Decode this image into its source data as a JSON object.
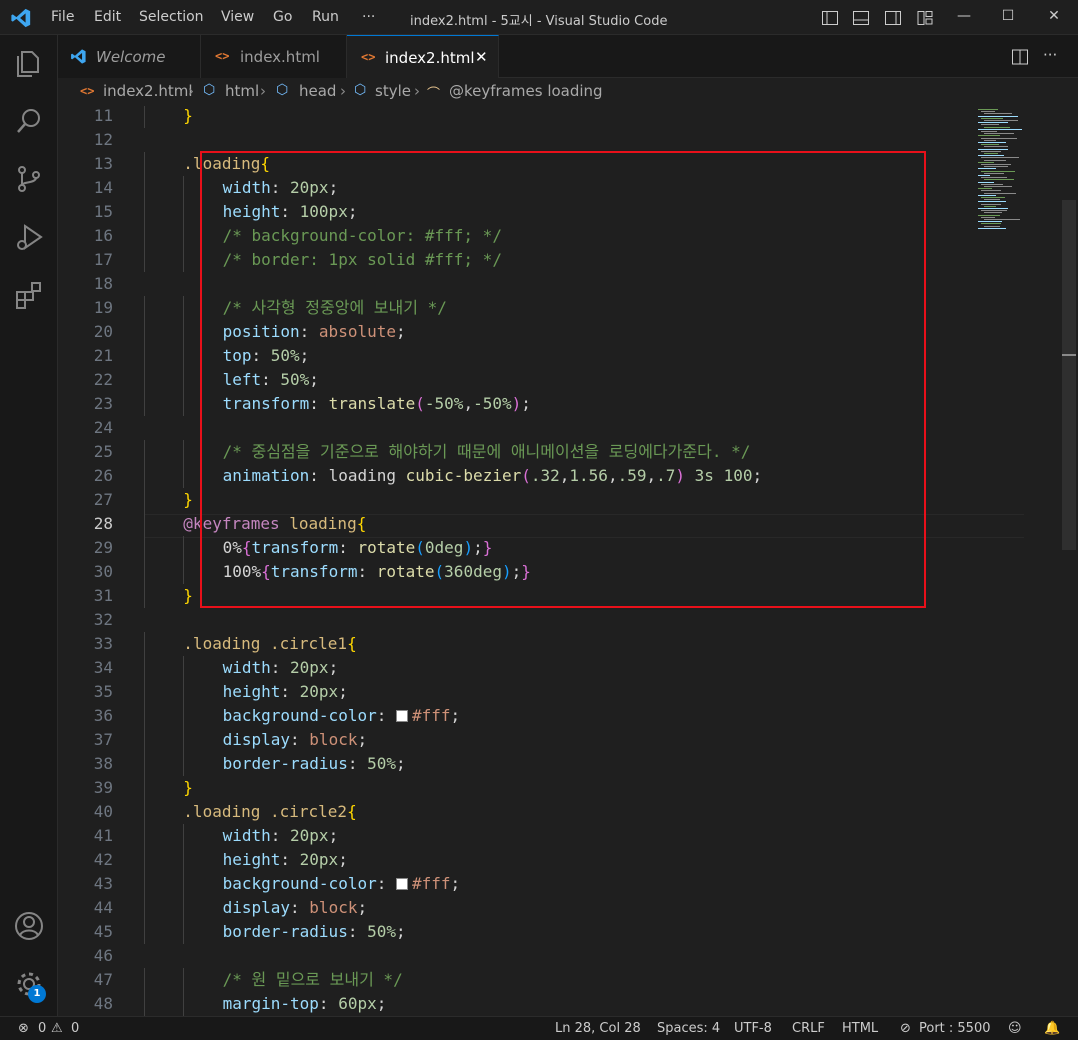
{
  "titlebar": {
    "menus": [
      "File",
      "Edit",
      "Selection",
      "View",
      "Go",
      "Run",
      "···"
    ],
    "window_title": "index2.html - 5교시 - Visual Studio Code"
  },
  "tabs": [
    {
      "label": "Welcome",
      "icon": "vscode-logo-icon",
      "active": false
    },
    {
      "label": "index.html",
      "icon": "html-file-icon",
      "active": false
    },
    {
      "label": "index2.html",
      "icon": "html-file-icon",
      "active": true
    }
  ],
  "breadcrumb": [
    "index2.html",
    "html",
    "head",
    "style",
    "@keyframes loading"
  ],
  "editor": {
    "current_line": 28,
    "lines": [
      {
        "n": "11",
        "indent": 2,
        "tokens": [
          [
            "br1",
            "}"
          ]
        ]
      },
      {
        "n": "12",
        "indent": 0,
        "tokens": []
      },
      {
        "n": "13",
        "indent": 2,
        "tokens": [
          [
            "sel",
            ".loading"
          ],
          [
            "br1",
            "{"
          ]
        ]
      },
      {
        "n": "14",
        "indent": 3,
        "tokens": [
          [
            "prop",
            "width"
          ],
          [
            "",
            ": "
          ],
          [
            "num",
            "20px"
          ],
          [
            "",
            ";"
          ]
        ]
      },
      {
        "n": "15",
        "indent": 3,
        "tokens": [
          [
            "prop",
            "height"
          ],
          [
            "",
            ": "
          ],
          [
            "num",
            "100px"
          ],
          [
            "",
            ";"
          ]
        ]
      },
      {
        "n": "16",
        "indent": 3,
        "tokens": [
          [
            "cmt",
            "/* background-color: #fff; */"
          ]
        ]
      },
      {
        "n": "17",
        "indent": 3,
        "tokens": [
          [
            "cmt",
            "/* border: 1px solid #fff; */"
          ]
        ]
      },
      {
        "n": "18",
        "indent": 0,
        "tokens": []
      },
      {
        "n": "19",
        "indent": 3,
        "tokens": [
          [
            "cmt",
            "/* 사각형 정중앙에 보내기 */"
          ]
        ]
      },
      {
        "n": "20",
        "indent": 3,
        "tokens": [
          [
            "prop",
            "position"
          ],
          [
            "",
            ": "
          ],
          [
            "val",
            "absolute"
          ],
          [
            "",
            ";"
          ]
        ]
      },
      {
        "n": "21",
        "indent": 3,
        "tokens": [
          [
            "prop",
            "top"
          ],
          [
            "",
            ": "
          ],
          [
            "num",
            "50%"
          ],
          [
            "",
            ";"
          ]
        ]
      },
      {
        "n": "22",
        "indent": 3,
        "tokens": [
          [
            "prop",
            "left"
          ],
          [
            "",
            ": "
          ],
          [
            "num",
            "50%"
          ],
          [
            "",
            ";"
          ]
        ]
      },
      {
        "n": "23",
        "indent": 3,
        "tokens": [
          [
            "prop",
            "transform"
          ],
          [
            "",
            ": "
          ],
          [
            "fn",
            "translate"
          ],
          [
            "br2",
            "("
          ],
          [
            "num",
            "-50%"
          ],
          [
            "",
            ","
          ],
          [
            "num",
            "-50%"
          ],
          [
            "br2",
            ")"
          ],
          [
            "",
            ";"
          ]
        ]
      },
      {
        "n": "24",
        "indent": 0,
        "tokens": []
      },
      {
        "n": "25",
        "indent": 3,
        "tokens": [
          [
            "cmt",
            "/* 중심점을 기준으로 해야하기 때문에 애니메이션을 로딩에다가준다. */"
          ]
        ]
      },
      {
        "n": "26",
        "indent": 3,
        "tokens": [
          [
            "prop",
            "animation"
          ],
          [
            "",
            ": "
          ],
          [
            "",
            "loading "
          ],
          [
            "fn",
            "cubic-bezier"
          ],
          [
            "br2",
            "("
          ],
          [
            "num",
            ".32"
          ],
          [
            "",
            ","
          ],
          [
            "num",
            "1.56"
          ],
          [
            "",
            ","
          ],
          [
            "num",
            ".59"
          ],
          [
            "",
            ","
          ],
          [
            "num",
            ".7"
          ],
          [
            "br2",
            ")"
          ],
          [
            "",
            " "
          ],
          [
            "num",
            "3s"
          ],
          [
            "",
            " "
          ],
          [
            "num",
            "100"
          ],
          [
            "",
            ";"
          ]
        ]
      },
      {
        "n": "27",
        "indent": 2,
        "tokens": [
          [
            "br1",
            "}"
          ]
        ]
      },
      {
        "n": "28",
        "indent": 2,
        "tokens": [
          [
            "at",
            "@keyframes"
          ],
          [
            "",
            " "
          ],
          [
            "sel",
            "loading"
          ],
          [
            "br1",
            "{"
          ]
        ]
      },
      {
        "n": "29",
        "indent": 3,
        "tokens": [
          [
            "",
            "0%"
          ],
          [
            "br2",
            "{"
          ],
          [
            "prop",
            "transform"
          ],
          [
            "",
            ": "
          ],
          [
            "fn",
            "rotate"
          ],
          [
            "br3",
            "("
          ],
          [
            "num",
            "0deg"
          ],
          [
            "br3",
            ")"
          ],
          [
            "",
            ";"
          ],
          [
            "br2",
            "}"
          ]
        ]
      },
      {
        "n": "30",
        "indent": 3,
        "tokens": [
          [
            "",
            "100%"
          ],
          [
            "br2",
            "{"
          ],
          [
            "prop",
            "transform"
          ],
          [
            "",
            ": "
          ],
          [
            "fn",
            "rotate"
          ],
          [
            "br3",
            "("
          ],
          [
            "num",
            "360deg"
          ],
          [
            "br3",
            ")"
          ],
          [
            "",
            ";"
          ],
          [
            "br2",
            "}"
          ]
        ]
      },
      {
        "n": "31",
        "indent": 2,
        "tokens": [
          [
            "br1",
            "}"
          ]
        ]
      },
      {
        "n": "32",
        "indent": 0,
        "tokens": []
      },
      {
        "n": "33",
        "indent": 2,
        "tokens": [
          [
            "sel",
            ".loading .circle1"
          ],
          [
            "br1",
            "{"
          ]
        ]
      },
      {
        "n": "34",
        "indent": 3,
        "tokens": [
          [
            "prop",
            "width"
          ],
          [
            "",
            ": "
          ],
          [
            "num",
            "20px"
          ],
          [
            "",
            ";"
          ]
        ]
      },
      {
        "n": "35",
        "indent": 3,
        "tokens": [
          [
            "prop",
            "height"
          ],
          [
            "",
            ": "
          ],
          [
            "num",
            "20px"
          ],
          [
            "",
            ";"
          ]
        ]
      },
      {
        "n": "36",
        "indent": 3,
        "tokens": [
          [
            "prop",
            "background-color"
          ],
          [
            "",
            ": "
          ],
          [
            "swatch",
            ""
          ],
          [
            "val",
            "#fff"
          ],
          [
            "",
            ";"
          ]
        ]
      },
      {
        "n": "37",
        "indent": 3,
        "tokens": [
          [
            "prop",
            "display"
          ],
          [
            "",
            ": "
          ],
          [
            "val",
            "block"
          ],
          [
            "",
            ";"
          ]
        ]
      },
      {
        "n": "38",
        "indent": 3,
        "tokens": [
          [
            "prop",
            "border-radius"
          ],
          [
            "",
            ": "
          ],
          [
            "num",
            "50%"
          ],
          [
            "",
            ";"
          ]
        ]
      },
      {
        "n": "39",
        "indent": 2,
        "tokens": [
          [
            "br1",
            "}"
          ]
        ]
      },
      {
        "n": "40",
        "indent": 2,
        "tokens": [
          [
            "sel",
            ".loading .circle2"
          ],
          [
            "br1",
            "{"
          ]
        ]
      },
      {
        "n": "41",
        "indent": 3,
        "tokens": [
          [
            "prop",
            "width"
          ],
          [
            "",
            ": "
          ],
          [
            "num",
            "20px"
          ],
          [
            "",
            ";"
          ]
        ]
      },
      {
        "n": "42",
        "indent": 3,
        "tokens": [
          [
            "prop",
            "height"
          ],
          [
            "",
            ": "
          ],
          [
            "num",
            "20px"
          ],
          [
            "",
            ";"
          ]
        ]
      },
      {
        "n": "43",
        "indent": 3,
        "tokens": [
          [
            "prop",
            "background-color"
          ],
          [
            "",
            ": "
          ],
          [
            "swatch",
            ""
          ],
          [
            "val",
            "#fff"
          ],
          [
            "",
            ";"
          ]
        ]
      },
      {
        "n": "44",
        "indent": 3,
        "tokens": [
          [
            "prop",
            "display"
          ],
          [
            "",
            ": "
          ],
          [
            "val",
            "block"
          ],
          [
            "",
            ";"
          ]
        ]
      },
      {
        "n": "45",
        "indent": 3,
        "tokens": [
          [
            "prop",
            "border-radius"
          ],
          [
            "",
            ": "
          ],
          [
            "num",
            "50%"
          ],
          [
            "",
            ";"
          ]
        ]
      },
      {
        "n": "46",
        "indent": 0,
        "tokens": []
      },
      {
        "n": "47",
        "indent": 3,
        "tokens": [
          [
            "cmt",
            "/* 원 밑으로 보내기 */"
          ]
        ]
      },
      {
        "n": "48",
        "indent": 3,
        "tokens": [
          [
            "prop",
            "margin-top"
          ],
          [
            "",
            ": "
          ],
          [
            "num",
            "60px"
          ],
          [
            "",
            ";"
          ]
        ]
      }
    ]
  },
  "statusbar": {
    "errors": "0",
    "warnings": "0",
    "position": "Ln 28, Col 28",
    "spaces": "Spaces: 4",
    "encoding": "UTF-8",
    "eol": "CRLF",
    "language": "HTML",
    "port": "Port : 5500"
  },
  "activity": {
    "manage_badge": "1"
  },
  "colors": {
    "accent": "#0078d4",
    "highlight_box": "#e8101a",
    "editor_bg": "#1f1f1f"
  }
}
